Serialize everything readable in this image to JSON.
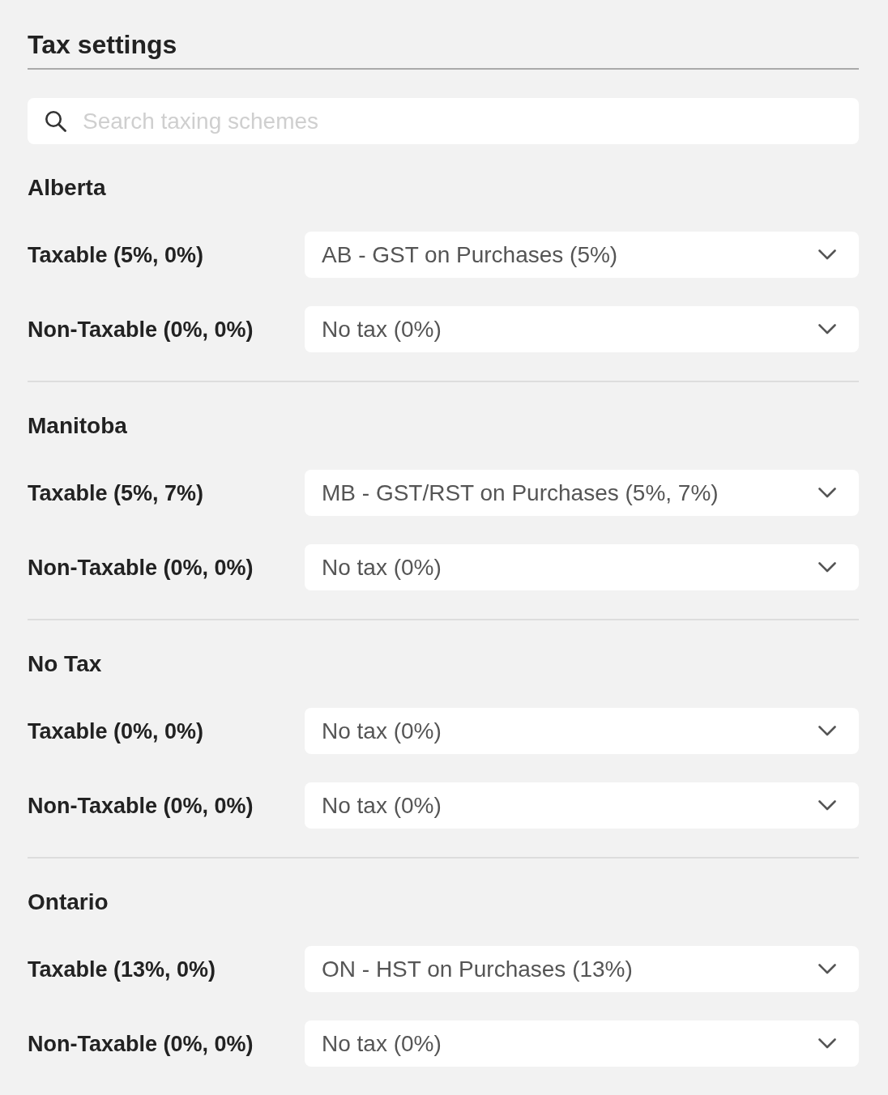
{
  "title": "Tax settings",
  "search": {
    "placeholder": "Search taxing schemes"
  },
  "regions": [
    {
      "name": "Alberta",
      "rows": [
        {
          "label": "Taxable (5%, 0%)",
          "value": "AB - GST on Purchases (5%)"
        },
        {
          "label": "Non-Taxable (0%, 0%)",
          "value": "No tax (0%)"
        }
      ]
    },
    {
      "name": "Manitoba",
      "rows": [
        {
          "label": "Taxable (5%, 7%)",
          "value": "MB - GST/RST on Purchases (5%, 7%)"
        },
        {
          "label": "Non-Taxable (0%, 0%)",
          "value": "No tax (0%)"
        }
      ]
    },
    {
      "name": "No Tax",
      "rows": [
        {
          "label": "Taxable (0%, 0%)",
          "value": "No tax (0%)"
        },
        {
          "label": "Non-Taxable (0%, 0%)",
          "value": "No tax (0%)"
        }
      ]
    },
    {
      "name": "Ontario",
      "rows": [
        {
          "label": "Taxable (13%, 0%)",
          "value": "ON - HST on Purchases (13%)"
        },
        {
          "label": "Non-Taxable (0%, 0%)",
          "value": "No tax (0%)"
        }
      ]
    }
  ]
}
